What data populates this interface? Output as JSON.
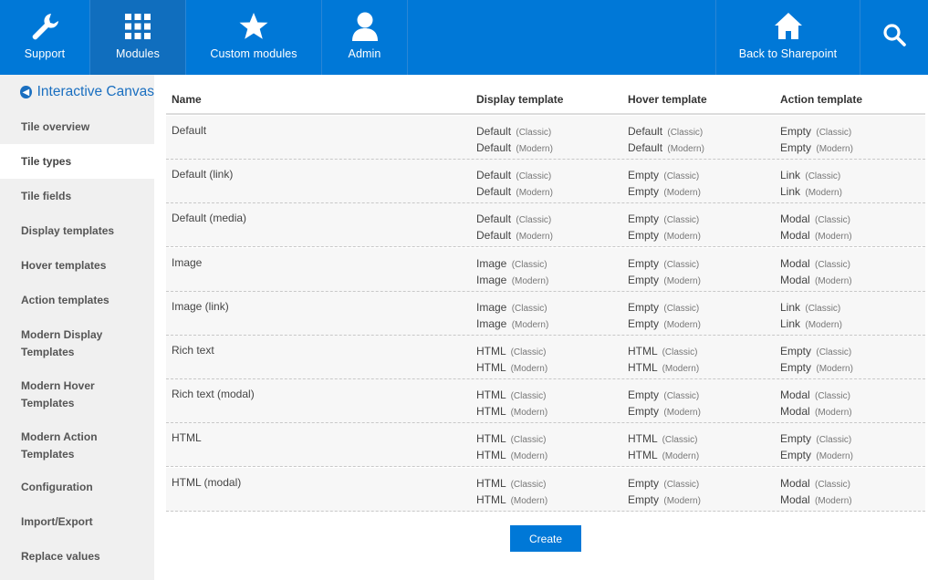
{
  "nav": {
    "support": "Support",
    "modules": "Modules",
    "custom_modules": "Custom modules",
    "admin": "Admin",
    "back": "Back to Sharepoint"
  },
  "sidebar": {
    "brand": "Interactive Canvas",
    "items": [
      {
        "label": "Tile overview"
      },
      {
        "label": "Tile types"
      },
      {
        "label": "Tile fields"
      },
      {
        "label": "Display templates"
      },
      {
        "label": "Hover templates"
      },
      {
        "label": "Action templates"
      },
      {
        "label": "Modern Display Templates"
      },
      {
        "label": "Modern Hover Templates"
      },
      {
        "label": "Modern Action Templates"
      },
      {
        "label": "Configuration"
      },
      {
        "label": "Import/Export"
      },
      {
        "label": "Replace values"
      }
    ]
  },
  "table": {
    "headers": [
      "Name",
      "Display template",
      "Hover template",
      "Action template"
    ],
    "rows": [
      {
        "name": "Default",
        "display": [
          "Default",
          "Default"
        ],
        "hover": [
          "Default",
          "Default"
        ],
        "action": [
          "Empty",
          "Empty"
        ]
      },
      {
        "name": "Default (link)",
        "display": [
          "Default",
          "Default"
        ],
        "hover": [
          "Empty",
          "Empty"
        ],
        "action": [
          "Link",
          "Link"
        ]
      },
      {
        "name": "Default (media)",
        "display": [
          "Default",
          "Default"
        ],
        "hover": [
          "Empty",
          "Empty"
        ],
        "action": [
          "Modal",
          "Modal"
        ]
      },
      {
        "name": "Image",
        "display": [
          "Image",
          "Image"
        ],
        "hover": [
          "Empty",
          "Empty"
        ],
        "action": [
          "Modal",
          "Modal"
        ]
      },
      {
        "name": "Image (link)",
        "display": [
          "Image",
          "Image"
        ],
        "hover": [
          "Empty",
          "Empty"
        ],
        "action": [
          "Link",
          "Link"
        ]
      },
      {
        "name": "Rich text",
        "display": [
          "HTML",
          "HTML"
        ],
        "hover": [
          "HTML",
          "HTML"
        ],
        "action": [
          "Empty",
          "Empty"
        ]
      },
      {
        "name": "Rich text (modal)",
        "display": [
          "HTML",
          "HTML"
        ],
        "hover": [
          "Empty",
          "Empty"
        ],
        "action": [
          "Modal",
          "Modal"
        ]
      },
      {
        "name": "HTML",
        "display": [
          "HTML",
          "HTML"
        ],
        "hover": [
          "HTML",
          "HTML"
        ],
        "action": [
          "Empty",
          "Empty"
        ]
      },
      {
        "name": "HTML (modal)",
        "display": [
          "HTML",
          "HTML"
        ],
        "hover": [
          "Empty",
          "Empty"
        ],
        "action": [
          "Modal",
          "Modal"
        ]
      }
    ],
    "tags": [
      "(Classic)",
      "(Modern)"
    ]
  },
  "create_label": "Create",
  "colors": {
    "accent": "#0078d7",
    "sidebar": "#f0f0f0",
    "brand": "#1a6fc0"
  }
}
